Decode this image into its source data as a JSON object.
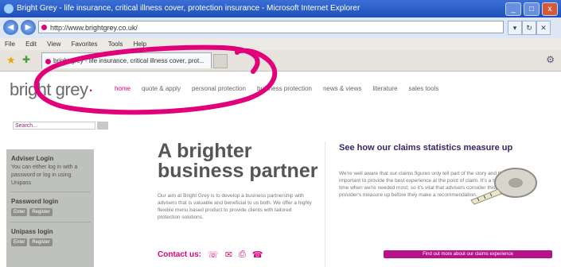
{
  "window": {
    "title": "Bright Grey - life insurance, critical illness cover, protection insurance - Microsoft Internet Explorer",
    "controls": [
      "_",
      "□",
      "x"
    ]
  },
  "browser": {
    "address": "http://www.brightgrey.co.uk/",
    "menu": [
      "File",
      "Edit",
      "View",
      "Favorites",
      "Tools",
      "Help"
    ],
    "tab_title": "bright grey - life insurance, critical illness cover, prot..."
  },
  "site": {
    "logo": "bright grey",
    "logo_mark": "·",
    "nav": [
      "home",
      "quote & apply",
      "personal protection",
      "business protection",
      "news & views",
      "literature",
      "sales tools"
    ],
    "search_placeholder": "Search...",
    "sidebar": {
      "adviser_heading": "Adviser Login",
      "adviser_text": "You can either log in with a password or log in using Unipass",
      "password_heading": "Password login",
      "unipass_heading": "Unipass login",
      "btn_enter": "Enter",
      "btn_register": "Register"
    },
    "hero": {
      "line1": "A brighter",
      "line2": "business partner",
      "body": "Our aim at Bright Grey is to develop a business partnership with advisers that is valuable and beneficial to us both. We offer a highly flexible menu based product to provide clients with tailored protection solutions.",
      "contact_label": "Contact us:"
    },
    "claims": {
      "heading": "See how our claims statistics measure up",
      "body": "We're well aware that our claims figures only tell part of the story and that it's really important to provide the best experience at the point of claim. It's a traumatic time – a time when we're needed most, so it's vital that advisers consider this aspect and their provider's measure up before they make a recommendation.",
      "button": "Find out more about our claims experience"
    }
  },
  "colors": {
    "brand_pink": "#e2007a",
    "brand_grey": "#6b6b6b",
    "title_blue": "#1d4fb9"
  }
}
